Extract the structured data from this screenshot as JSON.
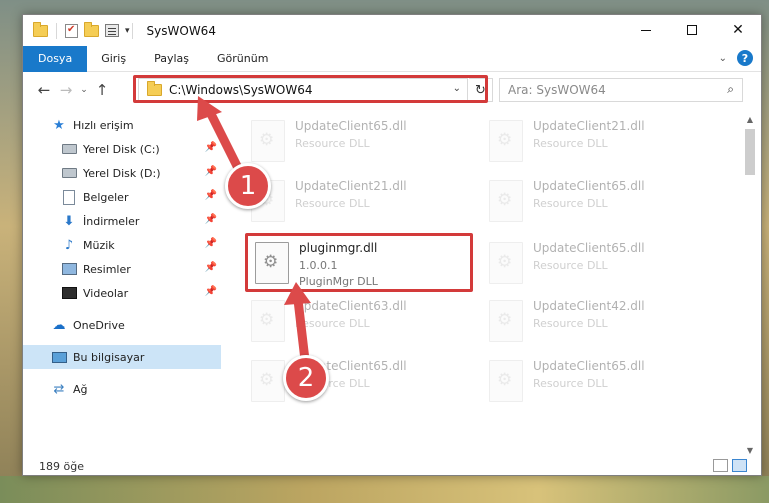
{
  "window": {
    "title": "SysWOW64",
    "qa_dropdown": "▾",
    "controls": {
      "close": "✕"
    }
  },
  "ribbon": {
    "tabs": [
      "Dosya",
      "Giriş",
      "Paylaş",
      "Görünüm"
    ],
    "active_tab": "Dosya",
    "expand_icon": "⌄",
    "help_label": "?"
  },
  "nav": {
    "back": "←",
    "forward": "→",
    "recent": "⌄",
    "up": "↑",
    "address": "C:\\Windows\\SysWOW64",
    "address_dropdown": "⌄",
    "refresh": "↻",
    "search_placeholder": "Ara: SysWOW64",
    "search_icon": "⌕"
  },
  "sidebar": {
    "items": [
      {
        "label": "Hızlı erişim",
        "icon": "star-icon"
      },
      {
        "label": "Yerel Disk (C:)",
        "icon": "drive-icon",
        "pinned": true
      },
      {
        "label": "Yerel Disk (D:)",
        "icon": "drive-icon",
        "pinned": true
      },
      {
        "label": "Belgeler",
        "icon": "documents-icon",
        "pinned": true
      },
      {
        "label": "İndirmeler",
        "icon": "download-icon",
        "pinned": true
      },
      {
        "label": "Müzik",
        "icon": "music-icon",
        "pinned": true
      },
      {
        "label": "Resimler",
        "icon": "pictures-icon",
        "pinned": true
      },
      {
        "label": "Videolar",
        "icon": "videos-icon",
        "pinned": true
      },
      {
        "label": "OneDrive",
        "icon": "cloud-icon"
      },
      {
        "label": "Bu bilgisayar",
        "icon": "computer-icon",
        "selected": true
      },
      {
        "label": "Ağ",
        "icon": "network-icon"
      }
    ],
    "pin_glyph": "📌"
  },
  "files": [
    {
      "name": "UpdateClient65.dll",
      "type": "Resource DLL"
    },
    {
      "name": "UpdateClient21.dll",
      "type": "Resource DLL"
    },
    {
      "name": "UpdateClient21.dll",
      "type": "Resource DLL"
    },
    {
      "name": "UpdateClient65.dll",
      "type": "Resource DLL"
    },
    {
      "name": "pluginmgr.dll",
      "version": "1.0.0.1",
      "type": "PluginMgr DLL"
    },
    {
      "name": "UpdateClient65.dll",
      "type": "Resource DLL"
    },
    {
      "name": "UpdateClient63.dll",
      "type": "Resource DLL"
    },
    {
      "name": "UpdateClient42.dll",
      "type": "Resource DLL"
    },
    {
      "name": "UpdateClient65.dll",
      "type": "Resource DLL"
    },
    {
      "name": "UpdateClient65.dll",
      "type": "Resource DLL"
    }
  ],
  "status": {
    "count": "189 öğe"
  },
  "callouts": [
    "1",
    "2"
  ],
  "colors": {
    "accent": "#1979ca",
    "highlight": "#d33a3a",
    "callout": "#dc4a4a"
  }
}
